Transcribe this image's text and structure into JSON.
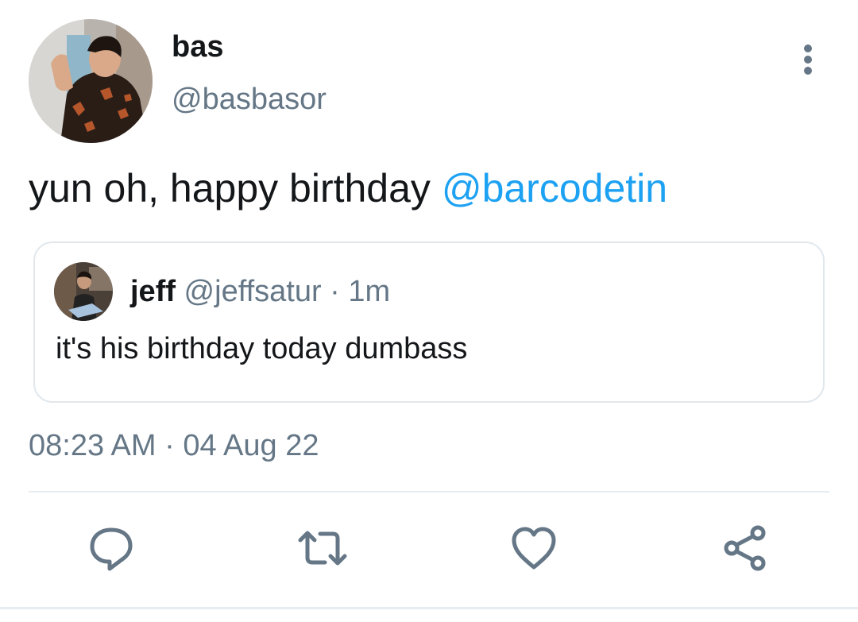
{
  "author": {
    "name": "bas",
    "handle": "@basbasor"
  },
  "tweet": {
    "text": "yun oh, happy birthday ",
    "mention": "@barcodetin"
  },
  "quoted": {
    "name": "jeff",
    "handle_time": " @jeffsatur · 1m",
    "text": "it's his birthday today dumbass"
  },
  "meta": {
    "timestamp": "08:23 AM · 04 Aug 22"
  },
  "icons": {
    "more": "more-vertical-icon",
    "reply": "reply-icon",
    "retweet": "retweet-icon",
    "like": "like-icon",
    "share": "share-icon"
  },
  "colors": {
    "mention": "#1da1f2",
    "secondary_text": "#657786",
    "icon": "#657786",
    "border": "#e1e8ed"
  }
}
